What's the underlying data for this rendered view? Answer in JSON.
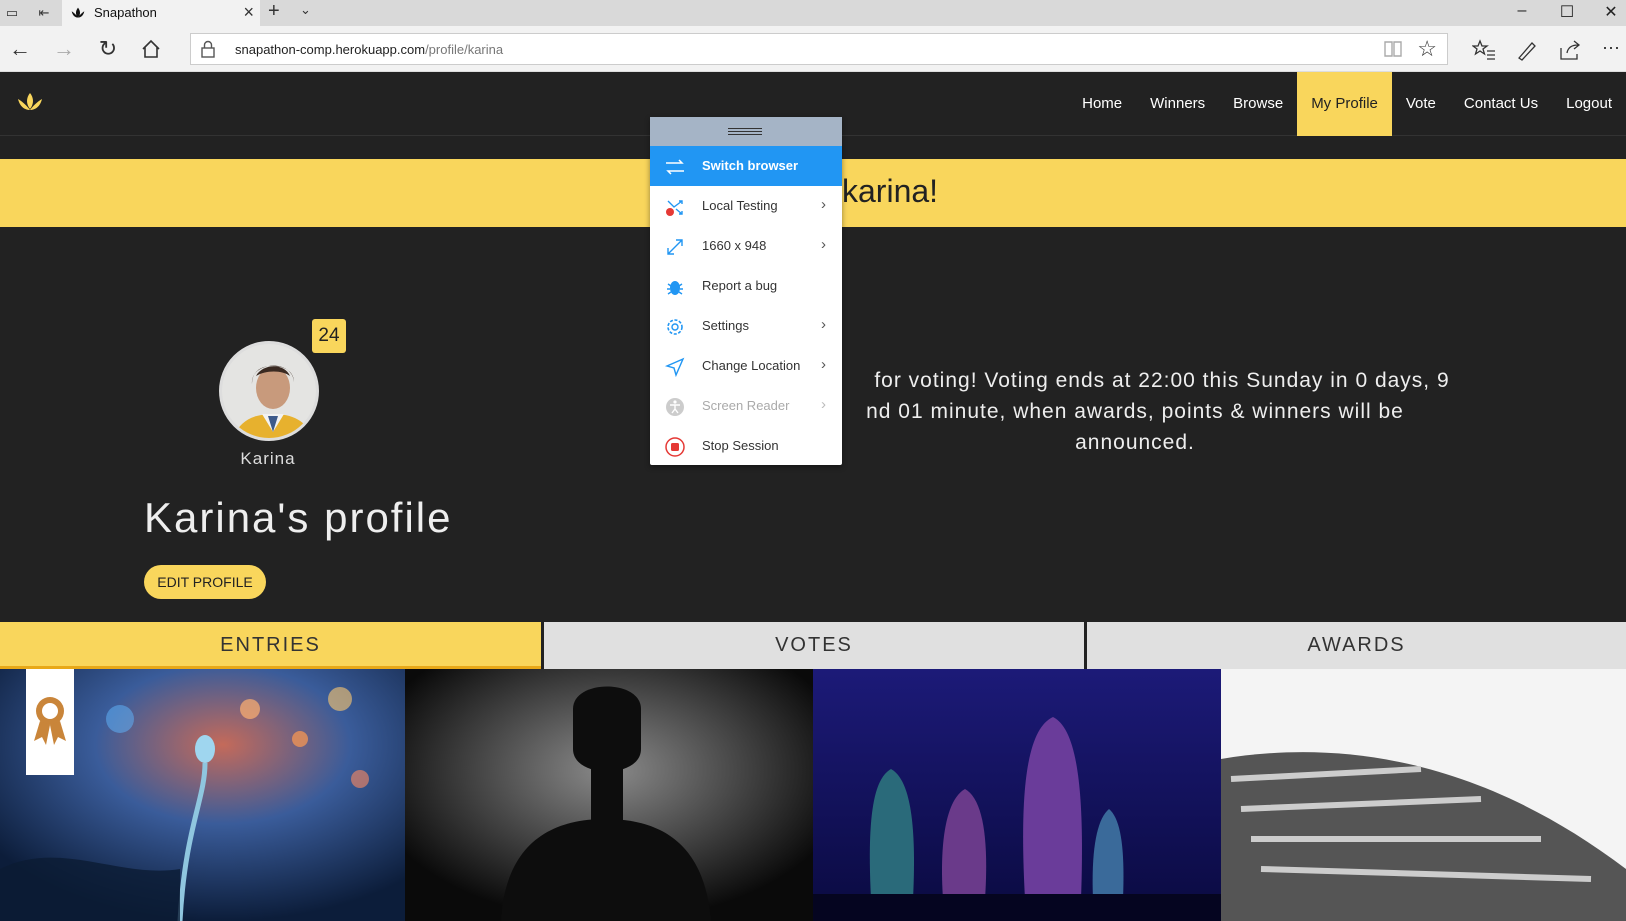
{
  "browser": {
    "tab_title": "Snapathon",
    "url_host": "snapathon-comp.herokuapp.com",
    "url_path": "/profile/karina"
  },
  "site": {
    "nav": [
      "Home",
      "Winners",
      "Browse",
      "My Profile",
      "Vote",
      "Contact Us",
      "Logout"
    ],
    "active_nav": "My Profile",
    "welcome_text": "karina!",
    "user_name": "Karina",
    "badge_count": "24",
    "profile_title": "Karina's profile",
    "edit_button": "EDIT PROFILE",
    "vote_message_line1": "for voting! Voting ends at 22:00 this Sunday in 0 days, 9",
    "vote_message_line2": "nd 01 minute, when awards, points & winners will be",
    "vote_message_line3": "announced.",
    "tabs": [
      "ENTRIES",
      "VOTES",
      "AWARDS"
    ],
    "active_tab": "ENTRIES"
  },
  "overlay_menu": {
    "items": [
      {
        "label": "Switch browser",
        "icon": "switch-browser-icon",
        "submenu": false,
        "state": "active"
      },
      {
        "label": "Local Testing",
        "icon": "local-testing-icon",
        "submenu": true,
        "state": "normal"
      },
      {
        "label": "1660 x 948",
        "icon": "resize-icon",
        "submenu": true,
        "state": "normal"
      },
      {
        "label": "Report a bug",
        "icon": "bug-icon",
        "submenu": false,
        "state": "normal"
      },
      {
        "label": "Settings",
        "icon": "gear-icon",
        "submenu": true,
        "state": "normal"
      },
      {
        "label": "Change Location",
        "icon": "location-arrow-icon",
        "submenu": true,
        "state": "normal"
      },
      {
        "label": "Screen Reader",
        "icon": "accessibility-icon",
        "submenu": true,
        "state": "disabled"
      },
      {
        "label": "Stop Session",
        "icon": "stop-icon",
        "submenu": false,
        "state": "normal"
      }
    ]
  },
  "colors": {
    "accent": "#f9d65c",
    "header_bg": "#222222",
    "menu_active": "#2196f3"
  }
}
